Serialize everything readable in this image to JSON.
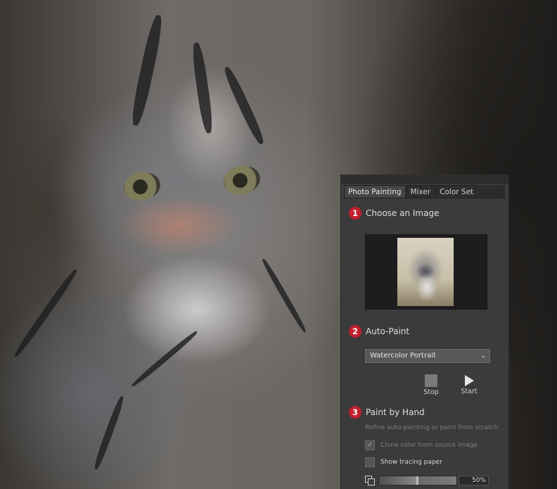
{
  "tabs": [
    {
      "label": "Photo Painting",
      "active": true
    },
    {
      "label": "Mixer",
      "active": false
    },
    {
      "label": "Color Set",
      "active": false
    }
  ],
  "sections": {
    "choose_image": {
      "number": "1",
      "title": "Choose an Image"
    },
    "auto_paint": {
      "number": "2",
      "title": "Auto-Paint"
    },
    "paint_by_hand": {
      "number": "3",
      "title": "Paint by Hand"
    }
  },
  "auto_paint": {
    "preset_selected": "Watercolor Portrait",
    "stop_label": "Stop",
    "start_label": "Start"
  },
  "paint_by_hand": {
    "hint": "Refine auto-painting or paint from scratch",
    "clone_color_label": "Clone color from source image",
    "clone_color_checked": true,
    "tracing_paper_label": "Show tracing paper",
    "tracing_paper_checked": false,
    "opacity_value": "50%",
    "opacity_fraction": 0.5
  },
  "colors": {
    "badge": "#c41f2f",
    "panel_bg": "#3b3b3b"
  },
  "icons": {
    "check": "check-icon",
    "chevron": "chevron-down-icon",
    "stop": "stop-icon",
    "start": "play-icon",
    "tracing": "tracing-paper-icon"
  }
}
